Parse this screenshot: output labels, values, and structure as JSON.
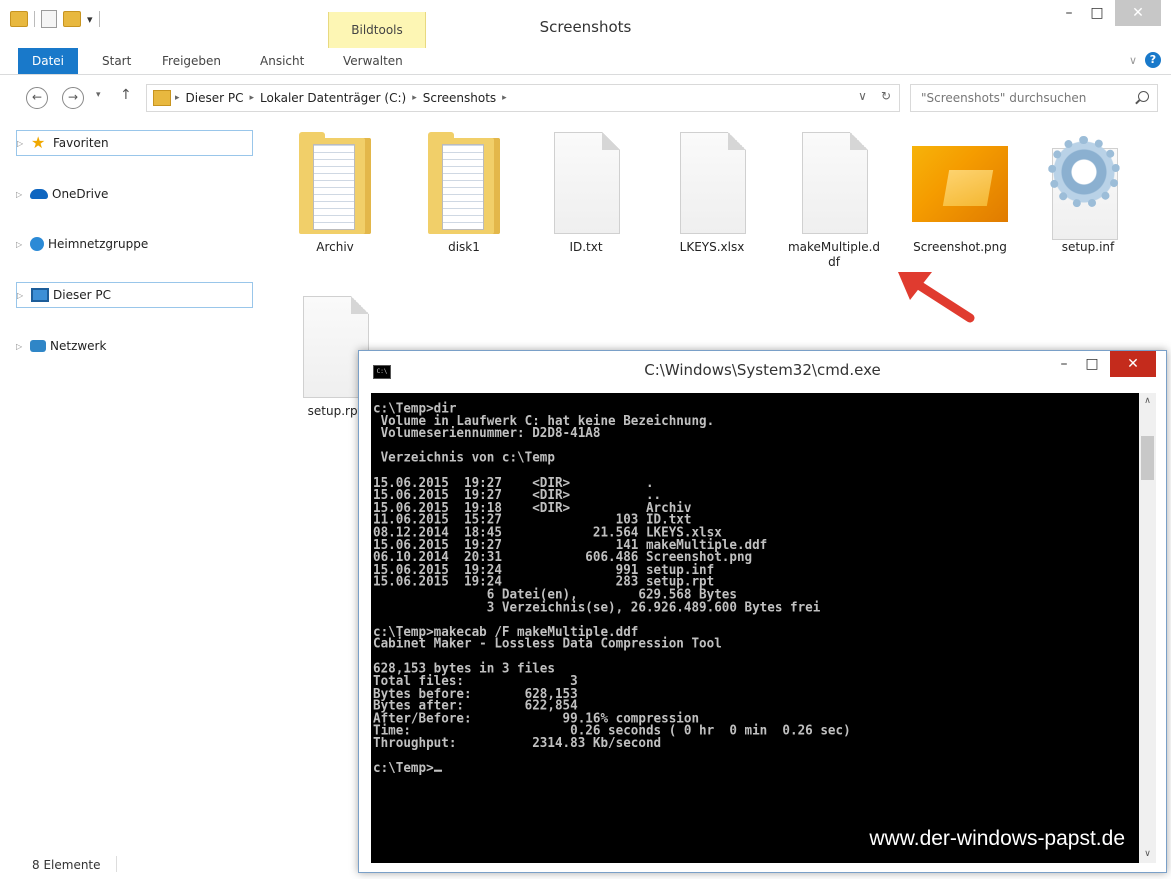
{
  "explorer": {
    "title": "Screenshots",
    "bildtools_label": "Bildtools",
    "window_controls": {
      "minimize": "–",
      "maximize": "□",
      "close": "✕"
    },
    "tabs": [
      "Datei",
      "Start",
      "Freigeben",
      "Ansicht",
      "Verwalten"
    ],
    "ribbon_right": {
      "expand": "∨",
      "help": "?"
    },
    "nav": {
      "back": "←",
      "forward": "→",
      "recent": "▾",
      "up": "↑"
    },
    "breadcrumbs": [
      "Dieser PC",
      "Lokaler Datenträger (C:)",
      "Screenshots"
    ],
    "breadcrumb_sep": "▸",
    "address_dropdown": "∨",
    "address_refresh": "↻",
    "search_placeholder": "\"Screenshots\" durchsuchen",
    "sidebar": [
      {
        "label": "Favoriten",
        "icon": "star-icon",
        "selected": true
      },
      {
        "label": "OneDrive",
        "icon": "cloud-icon",
        "selected": false
      },
      {
        "label": "Heimnetzgruppe",
        "icon": "homegroup-icon",
        "selected": false
      },
      {
        "label": "Dieser PC",
        "icon": "computer-icon",
        "selected": true
      },
      {
        "label": "Netzwerk",
        "icon": "network-icon",
        "selected": false
      }
    ],
    "files": [
      {
        "name": "Archiv",
        "type": "folder"
      },
      {
        "name": "disk1",
        "type": "folder"
      },
      {
        "name": "ID.txt",
        "type": "document"
      },
      {
        "name": "LKEYS.xlsx",
        "type": "document"
      },
      {
        "name": "makeMultiple.ddf",
        "type": "document"
      },
      {
        "name": "Screenshot.png",
        "type": "image"
      },
      {
        "name": "setup.inf",
        "type": "settings"
      },
      {
        "name": "setup.rpt",
        "type": "document"
      }
    ],
    "status": "8 Elemente"
  },
  "cmd": {
    "title": "C:\\Windows\\System32\\cmd.exe",
    "window_controls": {
      "minimize": "–",
      "maximize": "□",
      "close": "✕"
    },
    "lines": [
      "c:\\Temp>dir",
      " Volume in Laufwerk C: hat keine Bezeichnung.",
      " Volumeseriennummer: D2D8-41A8",
      "",
      " Verzeichnis von c:\\Temp",
      "",
      "15.06.2015  19:27    <DIR>          .",
      "15.06.2015  19:27    <DIR>          ..",
      "15.06.2015  19:18    <DIR>          Archiv",
      "11.06.2015  15:27               103 ID.txt",
      "08.12.2014  18:45            21.564 LKEYS.xlsx",
      "15.06.2015  19:27               141 makeMultiple.ddf",
      "06.10.2014  20:31           606.486 Screenshot.png",
      "15.06.2015  19:24               991 setup.inf",
      "15.06.2015  19:24               283 setup.rpt",
      "               6 Datei(en),        629.568 Bytes",
      "               3 Verzeichnis(se), 26.926.489.600 Bytes frei",
      "",
      "c:\\Temp>makecab /F makeMultiple.ddf",
      "Cabinet Maker - Lossless Data Compression Tool",
      "",
      "628,153 bytes in 3 files",
      "Total files:              3",
      "Bytes before:       628,153",
      "Bytes after:        622,854",
      "After/Before:            99.16% compression",
      "Time:                     0.26 seconds ( 0 hr  0 min  0.26 sec)",
      "Throughput:          2314.83 Kb/second",
      ""
    ],
    "prompt": "c:\\Temp>",
    "watermark": "www.der-windows-papst.de"
  }
}
